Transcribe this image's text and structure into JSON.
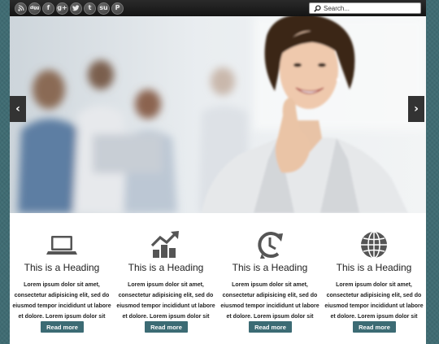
{
  "topbar": {
    "social_icons": [
      {
        "name": "rss-icon",
        "glyph": "◉"
      },
      {
        "name": "digg-icon",
        "glyph": "digg"
      },
      {
        "name": "facebook-icon",
        "glyph": "f"
      },
      {
        "name": "google-plus-icon",
        "glyph": "g+"
      },
      {
        "name": "twitter-icon",
        "glyph": "t"
      },
      {
        "name": "tumblr-icon",
        "glyph": "t"
      },
      {
        "name": "stumbleupon-icon",
        "glyph": "su"
      },
      {
        "name": "pinterest-icon",
        "glyph": "P"
      }
    ],
    "search": {
      "placeholder": "Search..."
    }
  },
  "slider": {
    "prev_glyph": "‹",
    "next_glyph": "›"
  },
  "features": [
    {
      "icon": "laptop-icon",
      "heading": "This is a Heading",
      "text": "Lorem ipsum dolor sit amet, consectetur adipisicing elit, sed do eiusmod tempor incididunt ut labore et dolore. Lorem ipsum dolor sit amet.",
      "button": "Read more"
    },
    {
      "icon": "growth-chart-icon",
      "heading": "This is a Heading",
      "text": "Lorem ipsum dolor sit amet, consectetur adipisicing elit, sed do eiusmod tempor incididunt ut labore et dolore. Lorem ipsum dolor sit amet.",
      "button": "Read more"
    },
    {
      "icon": "clock-arrow-icon",
      "heading": "This is a Heading",
      "text": "Lorem ipsum dolor sit amet, consectetur adipisicing elit, sed do eiusmod tempor incididunt ut labore et dolore. Lorem ipsum dolor sit amet.",
      "button": "Read more"
    },
    {
      "icon": "globe-icon",
      "heading": "This is a Heading",
      "text": "Lorem ipsum dolor sit amet, consectetur adipisicing elit, sed do eiusmod tempor incididunt ut labore et dolore. Lorem ipsum dolor sit amet.",
      "button": "Read more"
    }
  ],
  "colors": {
    "background": "#3f6c73",
    "button": "#3c6b74",
    "topbar": "#1c1c1c"
  }
}
